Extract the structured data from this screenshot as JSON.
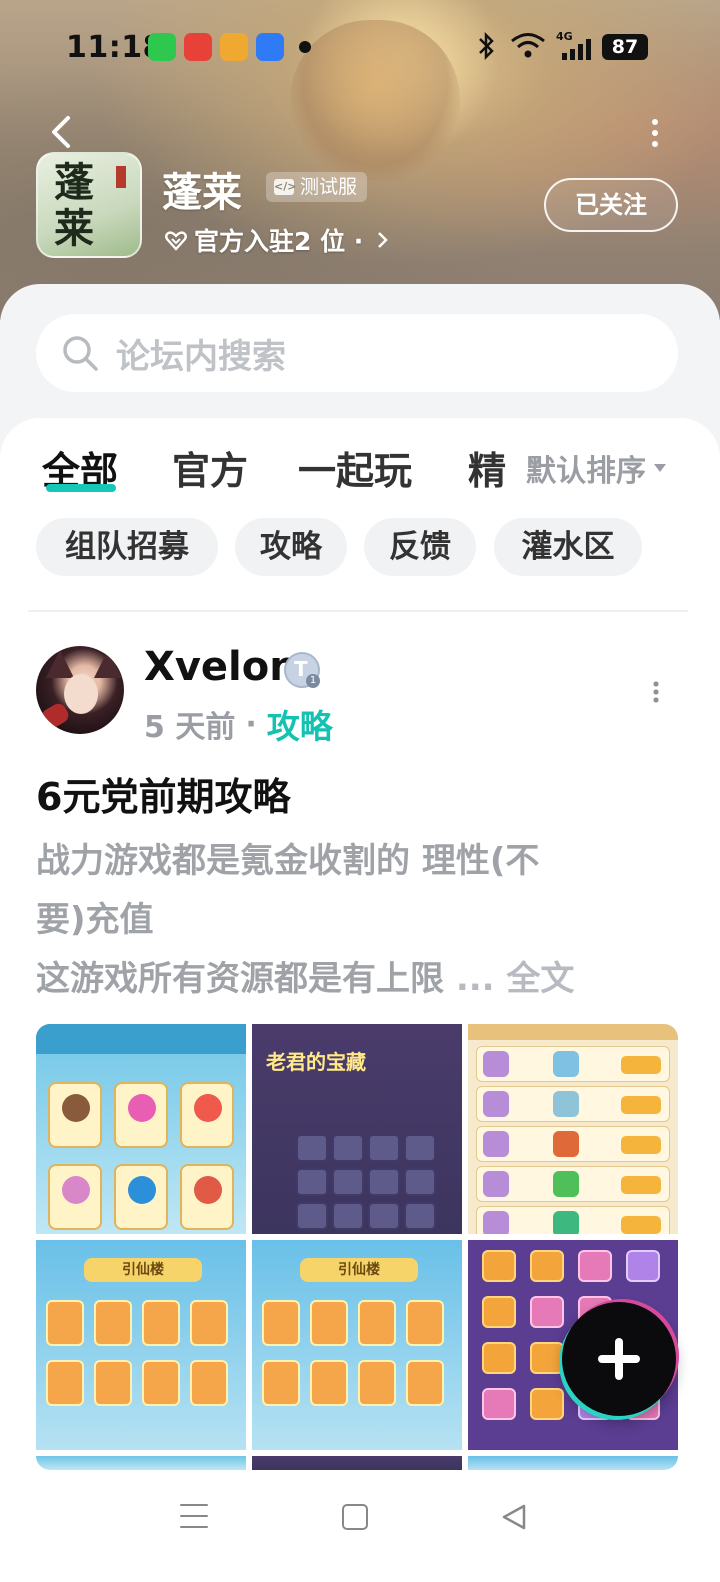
{
  "status_bar": {
    "time": "11:18",
    "battery": "87",
    "network": "4G",
    "app_icons": [
      "wechat-icon",
      "jd-mascot-icon",
      "wallet-icon",
      "blue-app-icon"
    ],
    "app_colors": [
      "#2dc84d",
      "#e8413a",
      "#f0a930",
      "#2f7bf5"
    ]
  },
  "header": {
    "game_name": "蓬莱",
    "icon_calligraphy": "蓬\n莱",
    "test_badge": "测试服",
    "official_text": "官方入驻2 位 ·",
    "follow_label": "已关注"
  },
  "search": {
    "placeholder": "论坛内搜索"
  },
  "tabs": {
    "items": [
      "全部",
      "官方",
      "一起玩",
      "精"
    ],
    "active": "全部",
    "sort_label": "默认排序"
  },
  "chips": [
    "组队招募",
    "攻略",
    "反馈",
    "灌水区"
  ],
  "post": {
    "username": "Xvelon",
    "level_badge": "T",
    "level_num": "1",
    "time_ago": "5 天前",
    "separator": "·",
    "category": "攻略",
    "title": "6元党前期攻略",
    "body_lines": [
      "战力游戏都是氪金收割的 理性(不",
      "要)充值",
      "这游戏所有资源都是有上限"
    ],
    "ellipsis": " ... ",
    "full_text_label": "全文",
    "images": [
      "shop-screenshot",
      "treasure-screenshot",
      "exchange-screenshot",
      "hero-screenshot",
      "hero-screenshot-2",
      "chest-screenshot"
    ],
    "image_texts": {
      "treasure_title": "老君的宝藏",
      "hero_banner": "引仙楼"
    }
  },
  "fab": {
    "icon": "plus-icon"
  },
  "navbar": {
    "icons": [
      "menu-icon",
      "home-icon",
      "back-icon"
    ]
  },
  "colors": {
    "accent": "#15c7b7",
    "category": "#14c2b2",
    "muted_text": "#9fa3a8"
  }
}
